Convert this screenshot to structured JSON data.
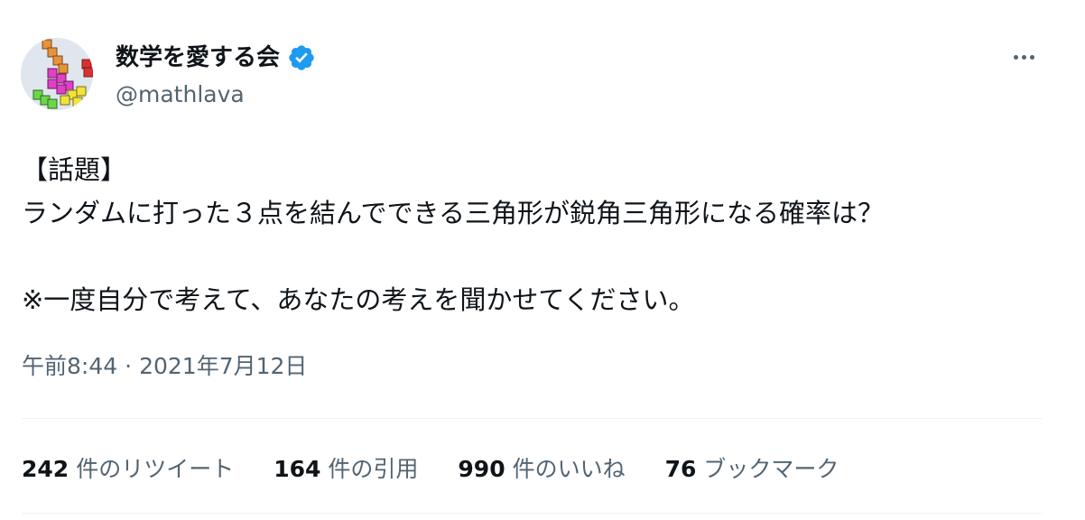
{
  "author": {
    "display_name": "数学を愛する会",
    "handle": "@mathlava",
    "verified": true
  },
  "tweet": {
    "lines": [
      "【話題】",
      "ランダムに打った３点を結んでできる三角形が鋭角三角形になる確率は？",
      "",
      "※一度自分で考えて、あなたの考えを聞かせてください。"
    ],
    "time": "午前8:44",
    "separator": "·",
    "date": "2021年7月12日"
  },
  "stats": {
    "retweets": {
      "count": "242",
      "label": "件のリツイート"
    },
    "quotes": {
      "count": "164",
      "label": "件の引用"
    },
    "likes": {
      "count": "990",
      "label": "件のいいね"
    },
    "bookmarks": {
      "count": "76",
      "label": "ブックマーク"
    }
  },
  "icons": {
    "verified": "verified-badge-icon",
    "more": "more-options-icon"
  },
  "colors": {
    "text_primary": "#0f1419",
    "text_secondary": "#536471",
    "verified_blue": "#1d9bf0",
    "divider": "#eff3f4"
  }
}
